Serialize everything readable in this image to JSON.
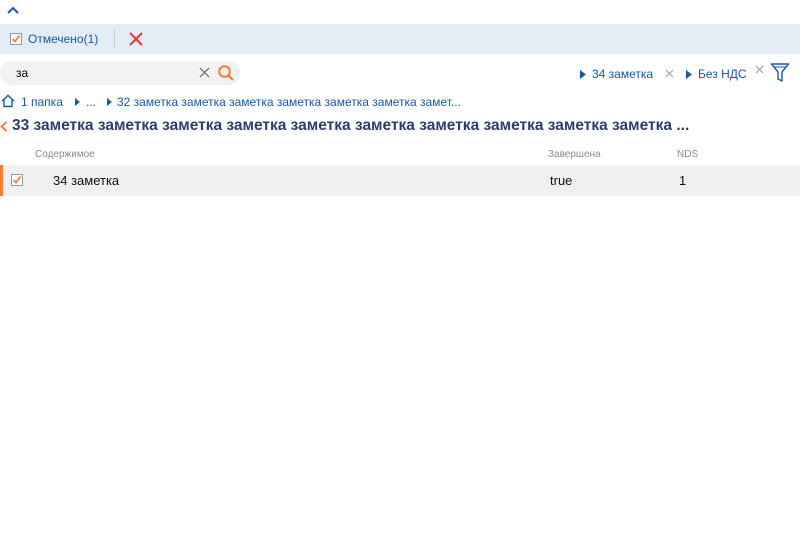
{
  "selection": {
    "label": "Отмечено(1)"
  },
  "search": {
    "value": "за",
    "placeholder": ""
  },
  "filters": [
    {
      "label": "34 заметка"
    },
    {
      "label": "Без НДС"
    }
  ],
  "breadcrumbs": {
    "items": [
      "1 папка",
      "...",
      "32 заметка заметка заметка заметка заметка заметка замет..."
    ]
  },
  "page": {
    "title": "33 заметка заметка заметка заметка заметка заметка заметка заметка заметка заметка ..."
  },
  "table": {
    "columns": [
      "Содержимое",
      "Завершена",
      "NDS"
    ],
    "rows": [
      {
        "checked": true,
        "content": "34 заметка",
        "completed": "true",
        "nds": "1"
      }
    ]
  },
  "colors": {
    "accent": "#f27f3c",
    "link": "#1a58a8",
    "title": "#2b3f6c",
    "toolbar_bg": "#e4ecf6",
    "clear": "#e23b3b"
  },
  "icons": [
    "chevron-up-icon",
    "checkbox-checked-icon",
    "close-icon",
    "clear-icon",
    "search-icon",
    "filter-funnel-icon",
    "home-icon",
    "triangle-right-icon",
    "chevron-left-icon"
  ]
}
